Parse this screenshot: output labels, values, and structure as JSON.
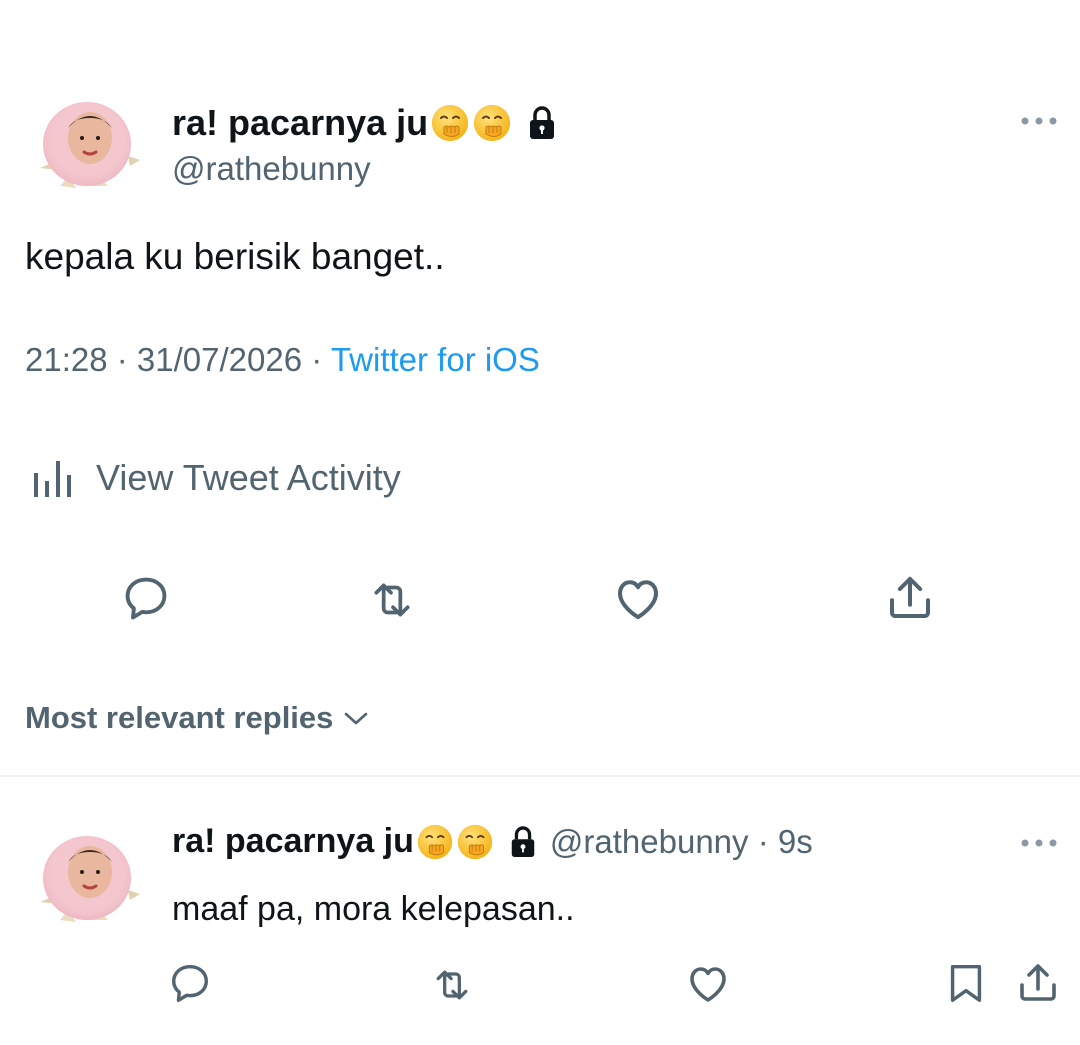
{
  "tweet": {
    "display_name": "ra! pacarnya ju",
    "handle": "@rathebunny",
    "text": "kepala ku berisik banget..",
    "time": "21:28",
    "separator1": " · ",
    "date": "31/07/2026",
    "separator2": " · ",
    "source": "Twitter for iOS",
    "activity_label": "View Tweet Activity",
    "name_emojis": [
      "face-with-hand-over-mouth-emoji",
      "face-with-hand-over-mouth-emoji"
    ],
    "protected_icon": "lock-icon"
  },
  "actions": [
    "reply-icon",
    "retweet-icon",
    "like-icon",
    "share-icon"
  ],
  "replies_header": {
    "label": "Most relevant replies"
  },
  "reply": {
    "display_name": "ra! pacarnya ju",
    "handle": "@rathebunny",
    "dot": " · ",
    "time_ago": "9s",
    "text": "maaf pa, mora kelepasan..",
    "actions": [
      "reply-icon",
      "retweet-icon",
      "like-icon",
      "bookmark-icon",
      "share-icon"
    ]
  },
  "colors": {
    "text_primary": "#0f1419",
    "text_secondary": "#536471",
    "link": "#1d9bf0",
    "divider": "#eff3f4",
    "emoji": "#fbc531"
  }
}
